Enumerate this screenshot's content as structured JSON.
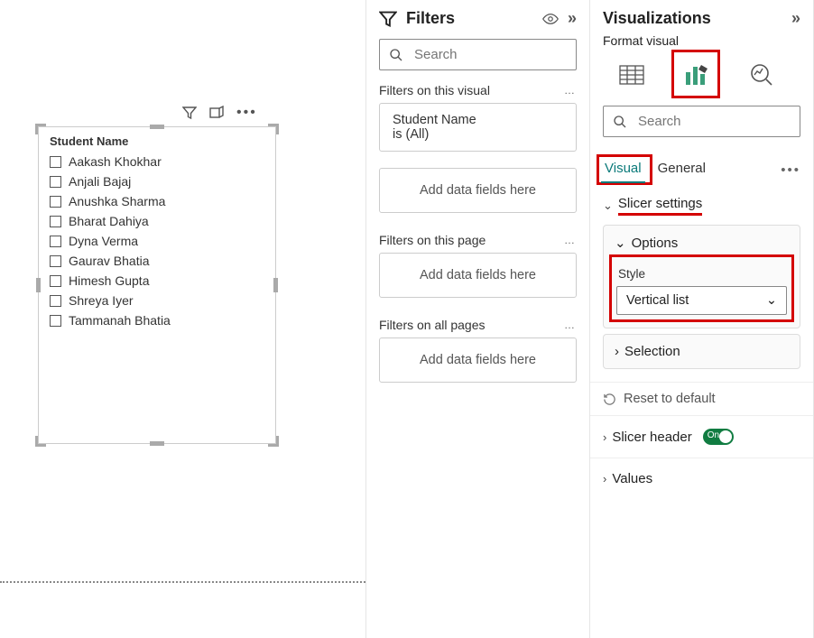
{
  "slicer": {
    "title": "Student Name",
    "items": [
      "Aakash Khokhar",
      "Anjali Bajaj",
      "Anushka Sharma",
      "Bharat Dahiya",
      "Dyna Verma",
      "Gaurav Bhatia",
      "Himesh Gupta",
      "Shreya Iyer",
      "Tammanah Bhatia"
    ]
  },
  "filters_pane": {
    "title": "Filters",
    "search_placeholder": "Search",
    "sections": {
      "visual": {
        "title": "Filters on this visual",
        "card_field": "Student Name",
        "card_condition": "is (All)",
        "dropzone": "Add data fields here"
      },
      "page": {
        "title": "Filters on this page",
        "dropzone": "Add data fields here"
      },
      "all": {
        "title": "Filters on all pages",
        "dropzone": "Add data fields here"
      }
    }
  },
  "viz_pane": {
    "title": "Visualizations",
    "subtitle": "Format visual",
    "search_placeholder": "Search",
    "tabs": {
      "visual": "Visual",
      "general": "General"
    },
    "slicer_settings": "Slicer settings",
    "options": {
      "header": "Options",
      "style_label": "Style",
      "style_value": "Vertical list"
    },
    "selection": "Selection",
    "reset": "Reset to default",
    "slicer_header": {
      "label": "Slicer header",
      "on": "On"
    },
    "values": "Values"
  }
}
